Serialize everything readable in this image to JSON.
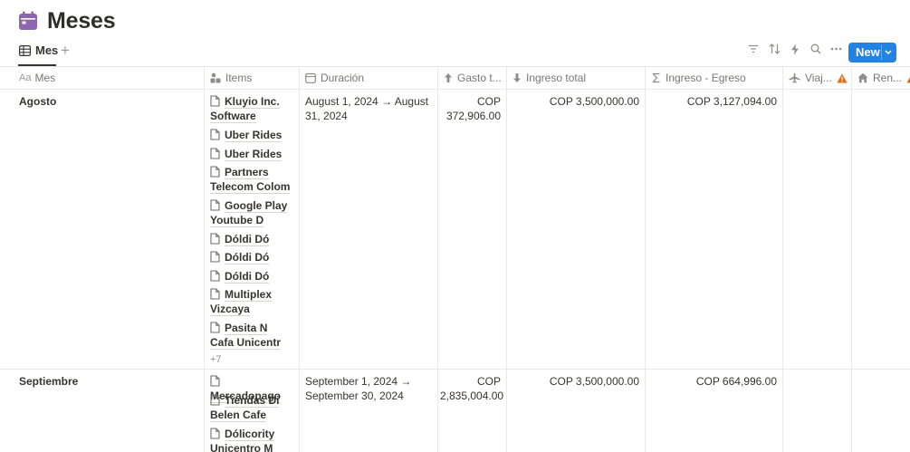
{
  "page": {
    "title": "Meses",
    "icon": "calendar-icon"
  },
  "view": {
    "tab_label": "Mes",
    "add_label": "+"
  },
  "toolbar": {
    "icons": [
      "filter-icon",
      "sort-icon",
      "lightning-icon",
      "search-icon",
      "more-icon"
    ],
    "new_label": "New",
    "accent": "#2383e2"
  },
  "columns": {
    "mes": {
      "prefix": "Aa",
      "label": "Mes"
    },
    "items": {
      "label": "Items"
    },
    "duracion": {
      "label": "Duración"
    },
    "gasto": {
      "label": "Gasto t..."
    },
    "ingreso": {
      "label": "Ingreso total"
    },
    "diferencia": {
      "label": "Ingreso - Egreso"
    },
    "viajes": {
      "label": "Viaj..."
    },
    "renta": {
      "label": "Ren..."
    }
  },
  "warning_color": "#e16b16",
  "rows": [
    {
      "mes": "Agosto",
      "items": [
        "Kluyio Inc. Software",
        "Uber Rides",
        "Uber Rides",
        "Partners Telecom Colom",
        "Google Play Youtube D",
        "Dóldi Dó",
        "Dóldi Dó",
        "Dóldi Dó",
        "Multiplex Vizcaya",
        "Pasita N Cafa Unicentr"
      ],
      "more": "+7",
      "duracion": "August 1, 2024 → August 31, 2024",
      "gasto": "COP 372,906.00",
      "ingreso": "COP 3,500,000.00",
      "diferencia": "COP 3,127,094.00"
    },
    {
      "mes": "Septiembre",
      "items": [
        "Mercadopago",
        "Tiendas Di Belen Cafe",
        "Dólicority Unicentro M"
      ],
      "duracion": "September 1, 2024 → September 30, 2024",
      "gasto": "COP 2,835,004.00",
      "ingreso": "COP 3,500,000.00",
      "diferencia": "COP 664,996.00"
    }
  ]
}
